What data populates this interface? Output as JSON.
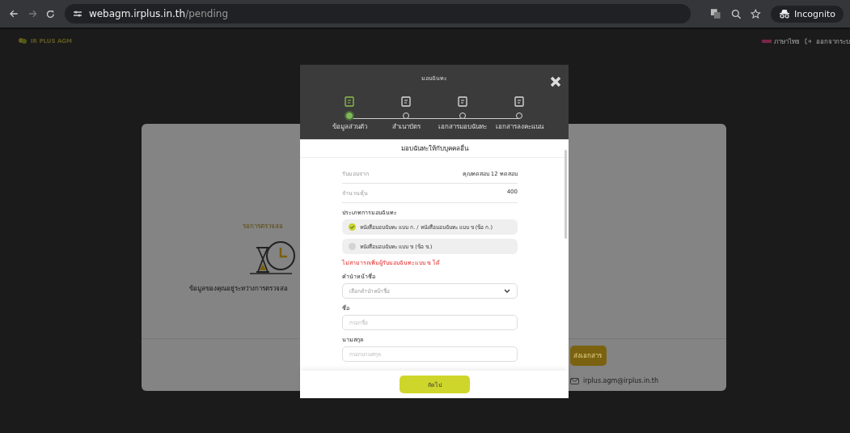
{
  "browser": {
    "url_host": "webagm.irplus.in.th",
    "url_path": "/pending",
    "profile": "Incognito"
  },
  "app_header": {
    "logo": "IR PLUS AGM",
    "language": "ภาษาไทย",
    "logout": "ออกจากระบ"
  },
  "status_card": {
    "title": "รอการตรวจสอ",
    "message": "ข้อมูลของคุณอยู่ระหว่างการตรวจสอ",
    "button": "ส่งเอกสาร",
    "email": "irplus.agm@irplus.in.th"
  },
  "modal": {
    "title": "มอบฉันทะ",
    "steps": [
      {
        "label": "ข้อมูลส่วนตัว",
        "selected": true
      },
      {
        "label": "สำเนาบัตร",
        "selected": false
      },
      {
        "label": "เอกสารมอบฉันทะ",
        "selected": false
      },
      {
        "label": "เอกสารลงคะแนน",
        "selected": false
      }
    ],
    "subtitle": "มอบฉันทะให้กับบุคคลอื่น",
    "info_rows": [
      {
        "label": "รับมอบจาก",
        "value": "คุณทดสอบ 12 ทดสอบ"
      },
      {
        "label": "จำนวนหุ้น",
        "value": "400"
      }
    ],
    "proxy_type": {
      "label": "ประเภทการมอบฉันทะ",
      "options": [
        {
          "label": "หนังสือมอบฉันทะ แบบ ก. / หนังสือมอบฉันทะ แบบ ข (ข้อ ก.)",
          "selected": true
        },
        {
          "label": "หนังสือมอบฉันทะ แบบ ข (ข้อ ข.)",
          "selected": false
        }
      ],
      "error": "ไม่สามารถเพิ่มผู้รับมอบฉันทะแบบ ข ได้"
    },
    "fields": [
      {
        "kind": "select",
        "label": "คำนำหน้าชื่อ",
        "placeholder": "เลือกคำนำหน้าชื่อ"
      },
      {
        "kind": "text",
        "label": "ชื่อ",
        "placeholder": "กรอกชื่อ"
      },
      {
        "kind": "text",
        "label": "นามสกุล",
        "placeholder": "กรอกนามสกุล"
      }
    ],
    "next_button": "ถัดไป"
  }
}
